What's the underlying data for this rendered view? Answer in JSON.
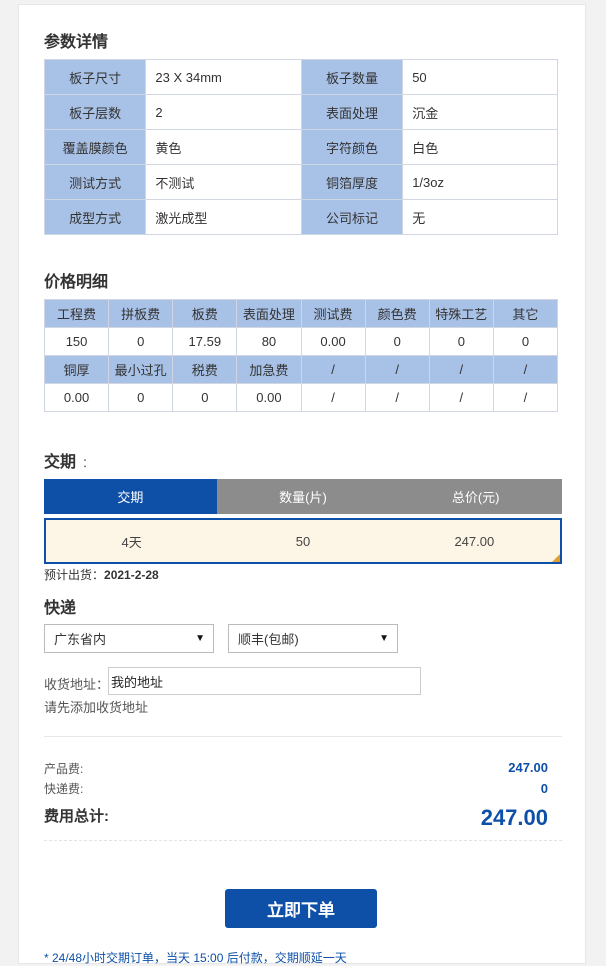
{
  "sections": {
    "params_title": "参数详情",
    "price_title": "价格明细",
    "delivery_title": "交期",
    "delivery_colon": "：",
    "express_title": "快递"
  },
  "params": [
    {
      "k1": "板子尺寸",
      "v1": "23 X 34mm",
      "k2": "板子数量",
      "v2": "50"
    },
    {
      "k1": "板子层数",
      "v1": "2",
      "k2": "表面处理",
      "v2": "沉金"
    },
    {
      "k1": "覆盖膜颜色",
      "v1": "黄色",
      "k2": "字符颜色",
      "v2": "白色"
    },
    {
      "k1": "测试方式",
      "v1": "不测试",
      "k2": "铜箔厚度",
      "v2": "1/3oz"
    },
    {
      "k1": "成型方式",
      "v1": "激光成型",
      "k2": "公司标记",
      "v2": "无"
    }
  ],
  "price": {
    "headers1": [
      "工程费",
      "拼板费",
      "板费",
      "表面处理",
      "测试费",
      "颜色费",
      "特殊工艺",
      "其它"
    ],
    "values1": [
      "150",
      "0",
      "17.59",
      "80",
      "0.00",
      "0",
      "0",
      "0"
    ],
    "headers2": [
      "铜厚",
      "最小过孔",
      "税费",
      "加急费",
      "/",
      "/",
      "/",
      "/"
    ],
    "values2": [
      "0.00",
      "0",
      "0",
      "0.00",
      "/",
      "/",
      "/",
      "/"
    ]
  },
  "delivery": {
    "tabs": [
      "交期",
      "数量(片)",
      "总价(元)"
    ],
    "row": {
      "days": "4天",
      "qty": "50",
      "total": "247.00"
    },
    "estimate_label": "预计出货：",
    "estimate_date": "2021-2-28"
  },
  "express": {
    "region": "广东省内",
    "carrier": "顺丰(包邮)",
    "address_label": "收货地址：",
    "address_value": "我的地址",
    "hint": "请先添加收货地址"
  },
  "fees": {
    "product_label": "产品费:",
    "product_value": "247.00",
    "shipping_label": "快递费:",
    "shipping_value": "0",
    "total_label": "费用总计:",
    "total_value": "247.00"
  },
  "order_button": "立即下单",
  "note": "* 24/48小时交期订单，当天 15:00 后付款，交期顺延一天"
}
